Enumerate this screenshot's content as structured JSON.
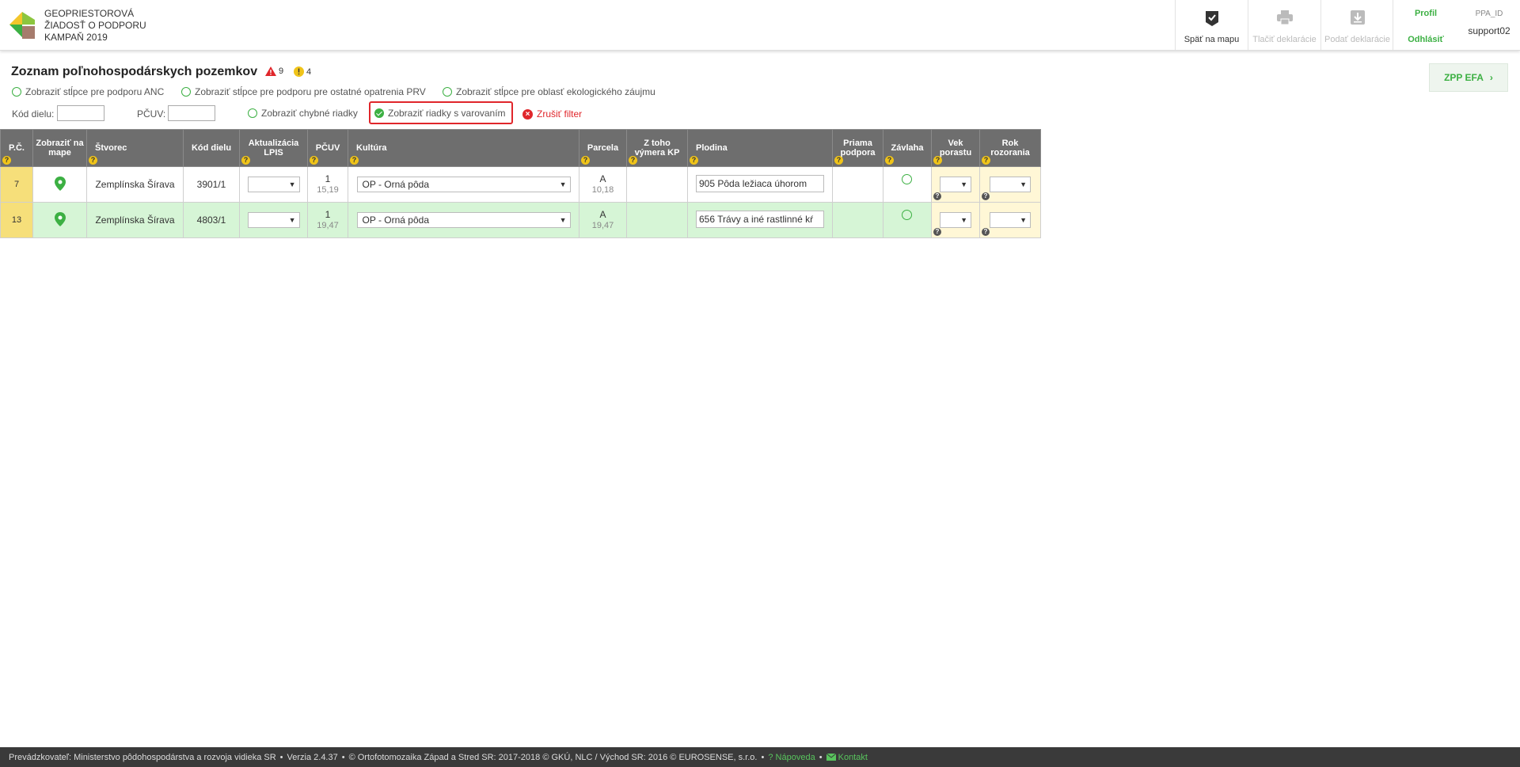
{
  "header": {
    "title_lines": [
      "GEOPRIESTOROVÁ",
      "ŽIADOSŤ O PODPORU",
      "KAMPAŇ 2019"
    ],
    "buttons": [
      {
        "label": "Späť na mapu",
        "icon": "map-check-icon",
        "enabled": true
      },
      {
        "label": "Tlačiť deklarácie",
        "icon": "printer-icon",
        "enabled": false
      },
      {
        "label": "Podať deklarácie",
        "icon": "download-icon",
        "enabled": false
      }
    ],
    "profile": "Profil",
    "logout": "Odhlásiť",
    "user_label": "PPA_ID",
    "user_name": "support02"
  },
  "page": {
    "title": "Zoznam poľnohospodárskych pozemkov",
    "error_count": "9",
    "warning_count": "4",
    "zpp_button": "ZPP EFA"
  },
  "options": {
    "anc": "Zobraziť stĺpce pre podporu ANC",
    "prv": "Zobraziť stĺpce pre podporu pre ostatné opatrenia PRV",
    "efa": "Zobraziť stĺpce pre oblasť ekologického záujmu"
  },
  "filters": {
    "kod_dielu_label": "Kód dielu:",
    "kod_dielu_value": "",
    "pcuv_label": "PČUV:",
    "pcuv_value": "",
    "show_errors": "Zobraziť chybné riadky",
    "show_warnings": "Zobraziť riadky s varovaním",
    "clear": "Zrušiť filter"
  },
  "table": {
    "columns": [
      "P.Č.",
      "Zobraziť na mape",
      "Štvorec",
      "Kód dielu",
      "Aktualizácia LPIS",
      "PČUV",
      "Kultúra",
      "Parcela",
      "Z toho výmera KP",
      "Plodina",
      "Priama podpora",
      "Závlaha",
      "Vek porastu",
      "Rok rozorania"
    ],
    "rows": [
      {
        "pc": "7",
        "stvorec": "Zemplínska Šírava",
        "kod_dielu": "3901/1",
        "lpis": "",
        "pcuv": "1",
        "pcuv_area": "15,19",
        "kultura": "OP - Orná pôda",
        "parcela": "A",
        "parcela_area": "10,18",
        "vymera_kp": "",
        "plodina": "905  Pôda ležiaca úhorom",
        "priama": "",
        "vek": "",
        "rok": ""
      },
      {
        "pc": "13",
        "stvorec": "Zemplínska Šírava",
        "kod_dielu": "4803/1",
        "lpis": "",
        "pcuv": "1",
        "pcuv_area": "19,47",
        "kultura": "OP - Orná pôda",
        "parcela": "A",
        "parcela_area": "19,47",
        "vymera_kp": "",
        "plodina": "656  Trávy a iné rastlinné kŕ",
        "priama": "",
        "vek": "",
        "rok": ""
      }
    ]
  },
  "footer": {
    "operator": "Prevádzkovateľ: Ministerstvo pôdohospodárstva a rozvoja vidieka SR",
    "version": "Verzia 2.4.37",
    "copyright": "© Ortofotomozaika Západ a Stred SR: 2017-2018 © GKÚ, NLC / Východ SR: 2016 © EUROSENSE, s.r.o.",
    "help": "Nápoveda",
    "contact": "Kontakt"
  },
  "colors": {
    "accent": "#3cb043",
    "error": "#e0262b",
    "header_bg": "#6e6e6e",
    "warning": "#f0c419"
  }
}
